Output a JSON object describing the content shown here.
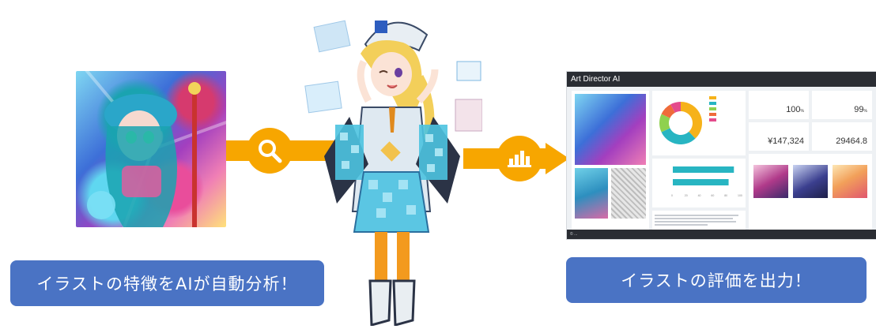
{
  "colors": {
    "arrow": "#f7a600",
    "caption_bg": "#4a73c4",
    "dashboard_header": "#2a2d33",
    "accent_teal": "#28b5c2"
  },
  "left_caption": "イラストの特徴をAIが自動分析！",
  "right_caption": "イラストの評価を出力！",
  "icons": {
    "analyze": "search-icon",
    "output": "bar-chart-icon"
  },
  "dashboard": {
    "title": "Art Director AI",
    "footer": "© ...",
    "donut": {
      "slices": [
        {
          "label": "",
          "value": 38,
          "color": "#f6b21a"
        },
        {
          "label": "",
          "value": 30,
          "color": "#28b5c2"
        },
        {
          "label": "",
          "value": 14,
          "color": "#8fd14f"
        },
        {
          "label": "",
          "value": 10,
          "color": "#ef6b3a"
        },
        {
          "label": "",
          "value": 8,
          "color": "#e44b8c"
        }
      ]
    },
    "bars": {
      "rows": [
        {
          "label": "",
          "value": 92
        },
        {
          "label": "",
          "value": 84
        }
      ],
      "ticks": [
        "0",
        "20",
        "40",
        "60",
        "80",
        "100"
      ]
    },
    "stats": [
      {
        "label": "",
        "value": "100",
        "unit": "%"
      },
      {
        "label": "",
        "value": "99",
        "unit": "%"
      },
      {
        "label": "",
        "value": "¥147,324",
        "unit": ""
      },
      {
        "label": "",
        "value": "29464.8",
        "unit": ""
      }
    ],
    "recommend": {
      "title": "",
      "items": [
        {
          "name": "",
          "desc": ""
        },
        {
          "name": "",
          "desc": ""
        },
        {
          "name": "",
          "desc": ""
        }
      ]
    }
  }
}
